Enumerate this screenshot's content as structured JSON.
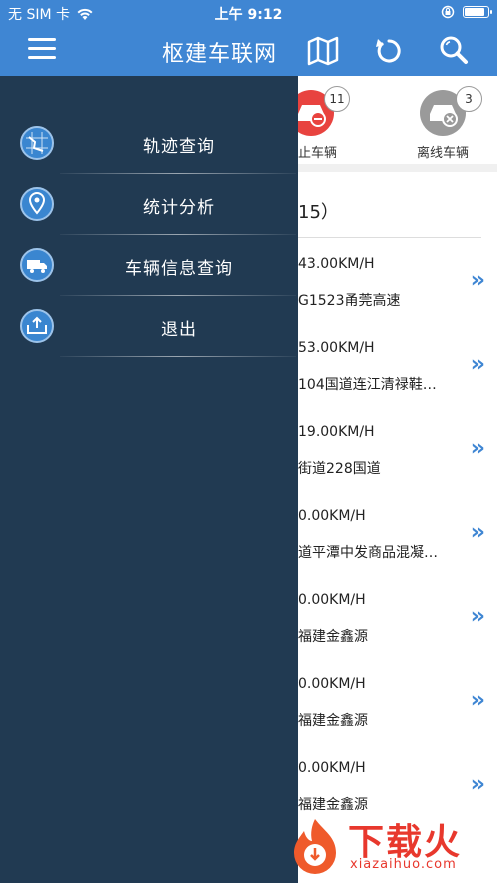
{
  "statusbar": {
    "carrier": "无 SIM 卡",
    "time": "上午 9:12",
    "battery_level": 0.9
  },
  "header": {
    "title": "枢建车联网"
  },
  "stats": [
    {
      "label": "停止车辆",
      "count": "11",
      "color": "#e8433f"
    },
    {
      "label": "离线车辆",
      "count": "3",
      "color": "#9a9a9a"
    }
  ],
  "list": {
    "title": "15）",
    "rows": [
      {
        "speed": "43.00KM/H",
        "addr": "G1523甬莞高速"
      },
      {
        "speed": "53.00KM/H",
        "addr": "104国道连江清禄鞋…"
      },
      {
        "speed": "19.00KM/H",
        "addr": "街道228国道"
      },
      {
        "speed": "0.00KM/H",
        "addr": "道平潭中发商品混凝…"
      },
      {
        "speed": "0.00KM/H",
        "addr": "福建金鑫源"
      },
      {
        "speed": "0.00KM/H",
        "addr": "福建金鑫源"
      },
      {
        "speed": "0.00KM/H",
        "addr": "福建金鑫源"
      }
    ]
  },
  "drawer": {
    "items": [
      {
        "label": "轨迹查询",
        "icon": "track-map-icon"
      },
      {
        "label": "统计分析",
        "icon": "location-pin-icon"
      },
      {
        "label": "车辆信息查询",
        "icon": "truck-icon"
      },
      {
        "label": "退出",
        "icon": "logout-icon"
      }
    ]
  },
  "watermark": {
    "brand": "下载火",
    "site": "xiazaihuo.com"
  },
  "colors": {
    "primary": "#3f86d3",
    "drawer_bg": "#213a52",
    "accent_red": "#e8382d"
  }
}
